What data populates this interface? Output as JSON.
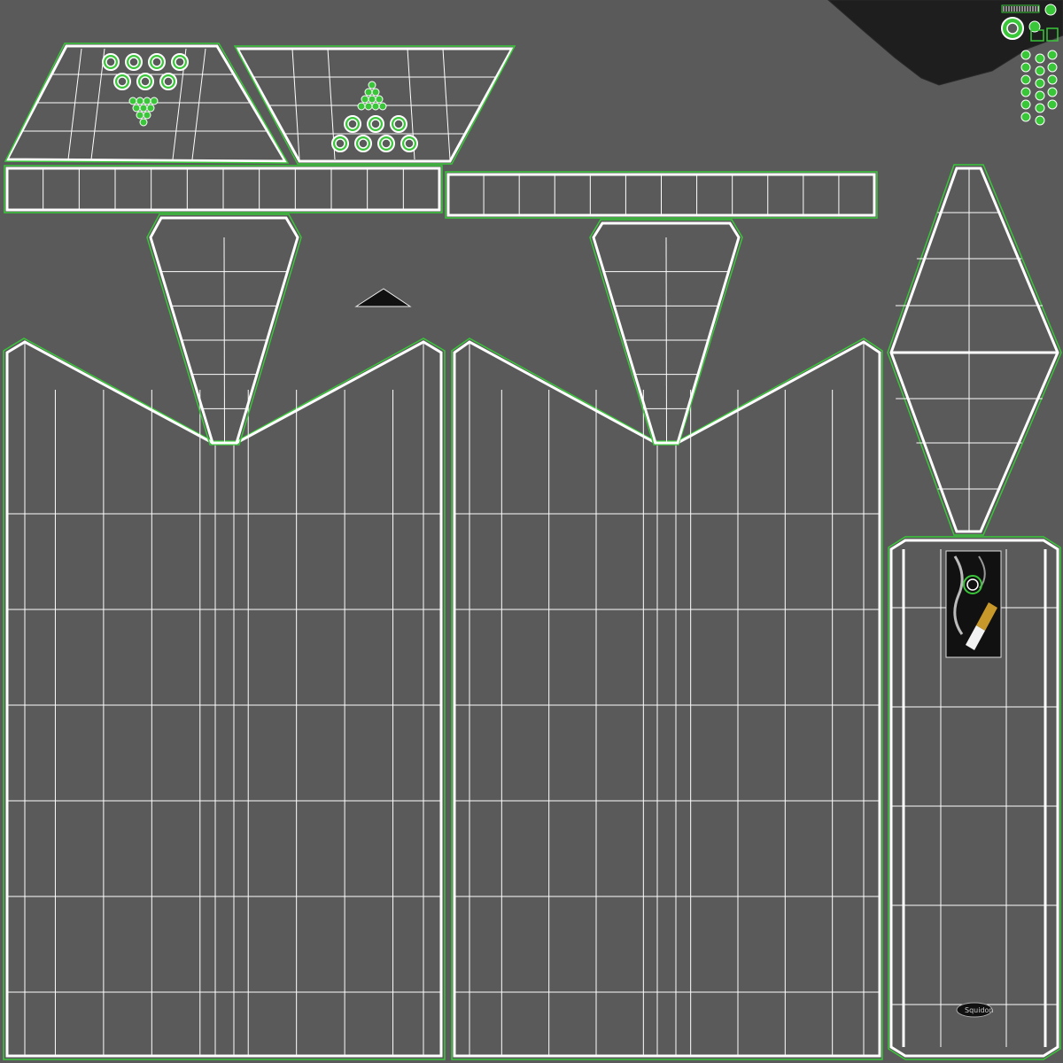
{
  "colors": {
    "background": "#5a5a5a",
    "wireframe": "#ffffff",
    "seam": "#39c739",
    "dark_region": "#1e1e1e",
    "filter_tip": "#c9982a"
  },
  "shells": {
    "lid_fan_left": "uv-shell",
    "lid_fan_right": "uv-shell",
    "band_strip_left": "uv-shell",
    "band_strip_right": "uv-shell",
    "side_panel_left": "uv-shell",
    "side_panel_right": "uv-shell",
    "diamond_cap": "uv-shell",
    "front_panel": "uv-shell"
  },
  "decal": {
    "icon": "cigarette-smoke-icon",
    "logo_text": "Squidon"
  }
}
